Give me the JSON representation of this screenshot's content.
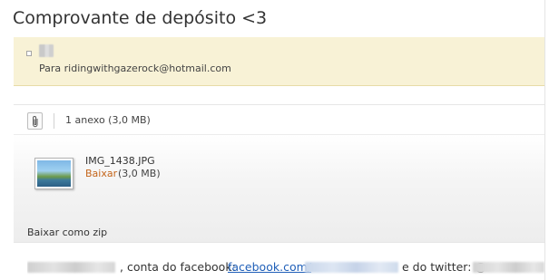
{
  "message": {
    "subject": "Comprovante de depósito <3",
    "to_line": "Para ridingwithgazerock@hotmail.com"
  },
  "attachments": {
    "count_label": "1 anexo (3,0 MB)",
    "items": [
      {
        "filename": "IMG_1438.JPG",
        "download_label": "Baixar",
        "size": "(3,0 MB)"
      }
    ],
    "zip_label": "Baixar como zip"
  },
  "body": {
    "facebook_text": ", conta do facebook:",
    "facebook_link": "facebook.com/",
    "twitter_text": "e do twitter: @"
  },
  "icons": {
    "attach": "paperclip-icon",
    "thumbnail": "image-thumbnail-icon"
  },
  "colors": {
    "sender_background": "#f8f2d6",
    "download_link": "#c4651a",
    "hyperlink": "#1f5fb8"
  }
}
